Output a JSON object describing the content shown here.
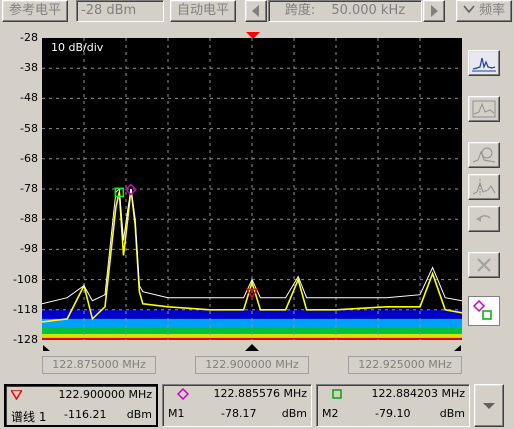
{
  "toolbar": {
    "ref_level_label": "参考电平",
    "ref_level_value": "-28 dBm",
    "auto_ref_label": "自动电平",
    "span_label": "跨度:",
    "span_value": "50.000 kHz",
    "freq_label": "频率"
  },
  "plot": {
    "scale_label": "10 dB/div",
    "y_ticks": [
      "-28",
      "-38",
      "-48",
      "-58",
      "-68",
      "-78",
      "-88",
      "-98",
      "-108",
      "-118",
      "-128"
    ],
    "x_ticks": [
      "122.875000 MHz",
      "122.900000 MHz",
      "122.925000 MHz"
    ]
  },
  "chart_data": {
    "type": "line",
    "ylim": [
      -128,
      -28
    ],
    "xlim_mhz": [
      122.875,
      122.925
    ],
    "ylabel": "",
    "xlabel": "",
    "grid": true,
    "series": [
      {
        "name": "",
        "color": "#ffff00",
        "x": [
          122.875,
          122.878,
          122.88,
          122.881,
          122.8825,
          122.8838,
          122.8842,
          122.8847,
          122.8852,
          122.8856,
          122.8861,
          122.8866,
          122.887,
          122.89,
          122.895,
          122.899,
          122.9,
          122.901,
          122.904,
          122.9055,
          122.9065,
          122.91,
          122.916,
          122.92,
          122.9215,
          122.923,
          122.925
        ],
        "y": [
          -122,
          -121,
          -110,
          -121,
          -117,
          -84,
          -79,
          -100,
          -88,
          -78,
          -90,
          -112,
          -116,
          -117,
          -118,
          -118,
          -109,
          -118,
          -118,
          -108,
          -118,
          -118,
          -117,
          -117,
          -106,
          -118,
          -119
        ]
      },
      {
        "name": "",
        "color": "#ffffff",
        "x": [
          122.875,
          122.878,
          122.88,
          122.881,
          122.8825,
          122.8838,
          122.8842,
          122.8847,
          122.8852,
          122.8856,
          122.8861,
          122.8866,
          122.887,
          122.89,
          122.895,
          122.899,
          122.9,
          122.901,
          122.904,
          122.9055,
          122.9065,
          122.91,
          122.916,
          122.92,
          122.9215,
          122.923,
          122.925
        ],
        "y": [
          -116,
          -114,
          -110,
          -115,
          -113,
          -79,
          -78,
          -95,
          -85,
          -78,
          -88,
          -110,
          -112,
          -114,
          -114,
          -114,
          -108,
          -114,
          -114,
          -107,
          -114,
          -114,
          -114,
          -113,
          -104,
          -114,
          -115
        ]
      }
    ]
  },
  "markers": [
    {
      "symbol_color": "#ff0000",
      "freq": "122.900000 MHz",
      "name": "谱线 1",
      "value": "-116.21",
      "unit": "dBm"
    },
    {
      "symbol_color": "#cc00cc",
      "freq": "122.885576 MHz",
      "name": "M1",
      "value": "-78.17",
      "unit": "dBm"
    },
    {
      "symbol_color": "#00cc00",
      "freq": "122.884203 MHz",
      "name": "M2",
      "value": "-79.10",
      "unit": "dBm"
    }
  ]
}
